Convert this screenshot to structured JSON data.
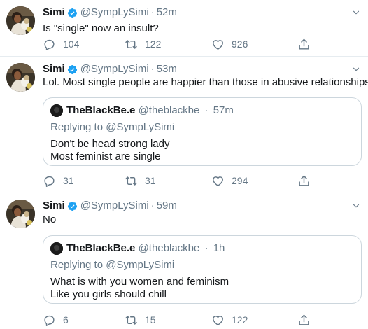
{
  "colors": {
    "text": "#14171a",
    "secondary": "#657786",
    "divider": "#e6ecf0",
    "verified": "#1da1f2",
    "border": "#ccd6dd"
  },
  "tweets": [
    {
      "name": "Simi",
      "handle": "@SympLySimi",
      "separator": "·",
      "time": "52m",
      "text": "Is \"single\" now an insult?",
      "replies": "104",
      "retweets": "122",
      "likes": "926"
    },
    {
      "name": "Simi",
      "handle": "@SympLySimi",
      "separator": "·",
      "time": "53m",
      "text": "Lol. Most single people are happier than those in abusive relationships.",
      "quote": {
        "name": "TheBlackBe.e",
        "handle": "@theblackbe",
        "separator": "·",
        "time": "57m",
        "replying": "Replying to @SympLySimi",
        "lines": [
          "Don't be head strong lady",
          "Most feminist are single"
        ]
      },
      "replies": "31",
      "retweets": "31",
      "likes": "294"
    },
    {
      "name": "Simi",
      "handle": "@SympLySimi",
      "separator": "·",
      "time": "59m",
      "text": "No",
      "quote": {
        "name": "TheBlackBe.e",
        "handle": "@theblackbe",
        "separator": "·",
        "time": "1h",
        "replying": "Replying to @SympLySimi",
        "lines": [
          "What is with you women and feminism",
          "Like you girls should chill"
        ]
      },
      "replies": "6",
      "retweets": "15",
      "likes": "122"
    }
  ]
}
